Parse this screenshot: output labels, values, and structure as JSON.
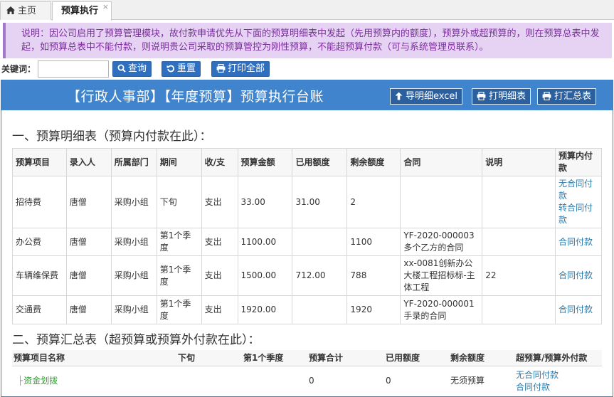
{
  "tabs": {
    "home_label": "主页",
    "active_label": "预算执行",
    "close_glyph": "×"
  },
  "notice": {
    "text": "说明：因公司启用了预算管理模块，故付款申请优先从下面的预算明细表中发起（先用预算内的额度），预算外或超预算的，则在预算总表中发起，如预算总表中不能付款，则说明贵公司采取的预算管控为刚性预算，不能超预算付款（可与系统管理员联系）。"
  },
  "search": {
    "label": "关键词：",
    "value": "",
    "placeholder": "",
    "query_label": "查询",
    "reset_label": "重置",
    "print_all_label": "打印全部"
  },
  "panel": {
    "title": "【行政人事部】【年度预算】预算执行台账",
    "export_label": "导明细excel",
    "print_detail_label": "打明细表",
    "print_summary_label": "打汇总表"
  },
  "detail": {
    "title": "一、预算明细表（预算内付款在此）：",
    "headers": {
      "item": "预算项目",
      "entered_by": "录入人",
      "department": "所属部门",
      "period": "期间",
      "direction": "收/支",
      "amount": "预算金额",
      "used": "已用额度",
      "remaining": "剩余额度",
      "contract": "合同",
      "note": "说明",
      "pay_action": "预算内付款"
    },
    "rows": [
      {
        "item": "招待费",
        "entered_by": "唐僧",
        "department": "采购小组",
        "period": "下旬",
        "direction": "支出",
        "amount": "33.00",
        "used": "31.00",
        "remaining": "2",
        "contract": "",
        "note": "",
        "action1": "无合同付款",
        "action2": "转合同付款"
      },
      {
        "item": "办公费",
        "entered_by": "唐僧",
        "department": "采购小组",
        "period": "第1个季度",
        "direction": "支出",
        "amount": "1100.00",
        "used": "",
        "remaining": "1100",
        "contract": "YF-2020-000003多个乙方的合同",
        "note": "",
        "action1": "合同付款"
      },
      {
        "item": "车辆维保费",
        "entered_by": "唐僧",
        "department": "采购小组",
        "period": "第1个季度",
        "direction": "支出",
        "amount": "1500.00",
        "used": "712.00",
        "remaining": "788",
        "contract": "xx-0081创新办公大楼工程招标标-主体工程",
        "note": "22",
        "action1": "合同付款"
      },
      {
        "item": "交通费",
        "entered_by": "唐僧",
        "department": "采购小组",
        "period": "第1个季度",
        "direction": "支出",
        "amount": "1920.00",
        "used": "",
        "remaining": "1920",
        "contract": "YF-2020-000001手录的合同",
        "note": "",
        "action1": "合同付款"
      }
    ]
  },
  "summary": {
    "title": "二、预算汇总表（超预算或预算外付款在此）：",
    "headers": {
      "name": "预算项目名称",
      "late": "下旬",
      "q1": "第1个季度",
      "total": "预算合计",
      "used": "已用额度",
      "remaining": "剩余额度",
      "action": "超预算/预算外付款"
    },
    "rows": [
      {
        "tree_mark": "├",
        "name": "资金划拨",
        "late": "",
        "q1": "",
        "total": "0",
        "used": "0",
        "remaining": "无须预算",
        "action1": "无合同付款",
        "action2": "合同付款"
      }
    ]
  },
  "colors": {
    "primary": "#3f84cc",
    "button": "#2f6fc0",
    "notice_bg": "#e6d3f3",
    "notice_text": "#7a2e9c",
    "link": "#2e7bab",
    "tree_link": "#2c9a2c"
  },
  "icons": [
    "home-icon",
    "search-icon",
    "reset-icon",
    "print-icon",
    "upload-icon"
  ]
}
